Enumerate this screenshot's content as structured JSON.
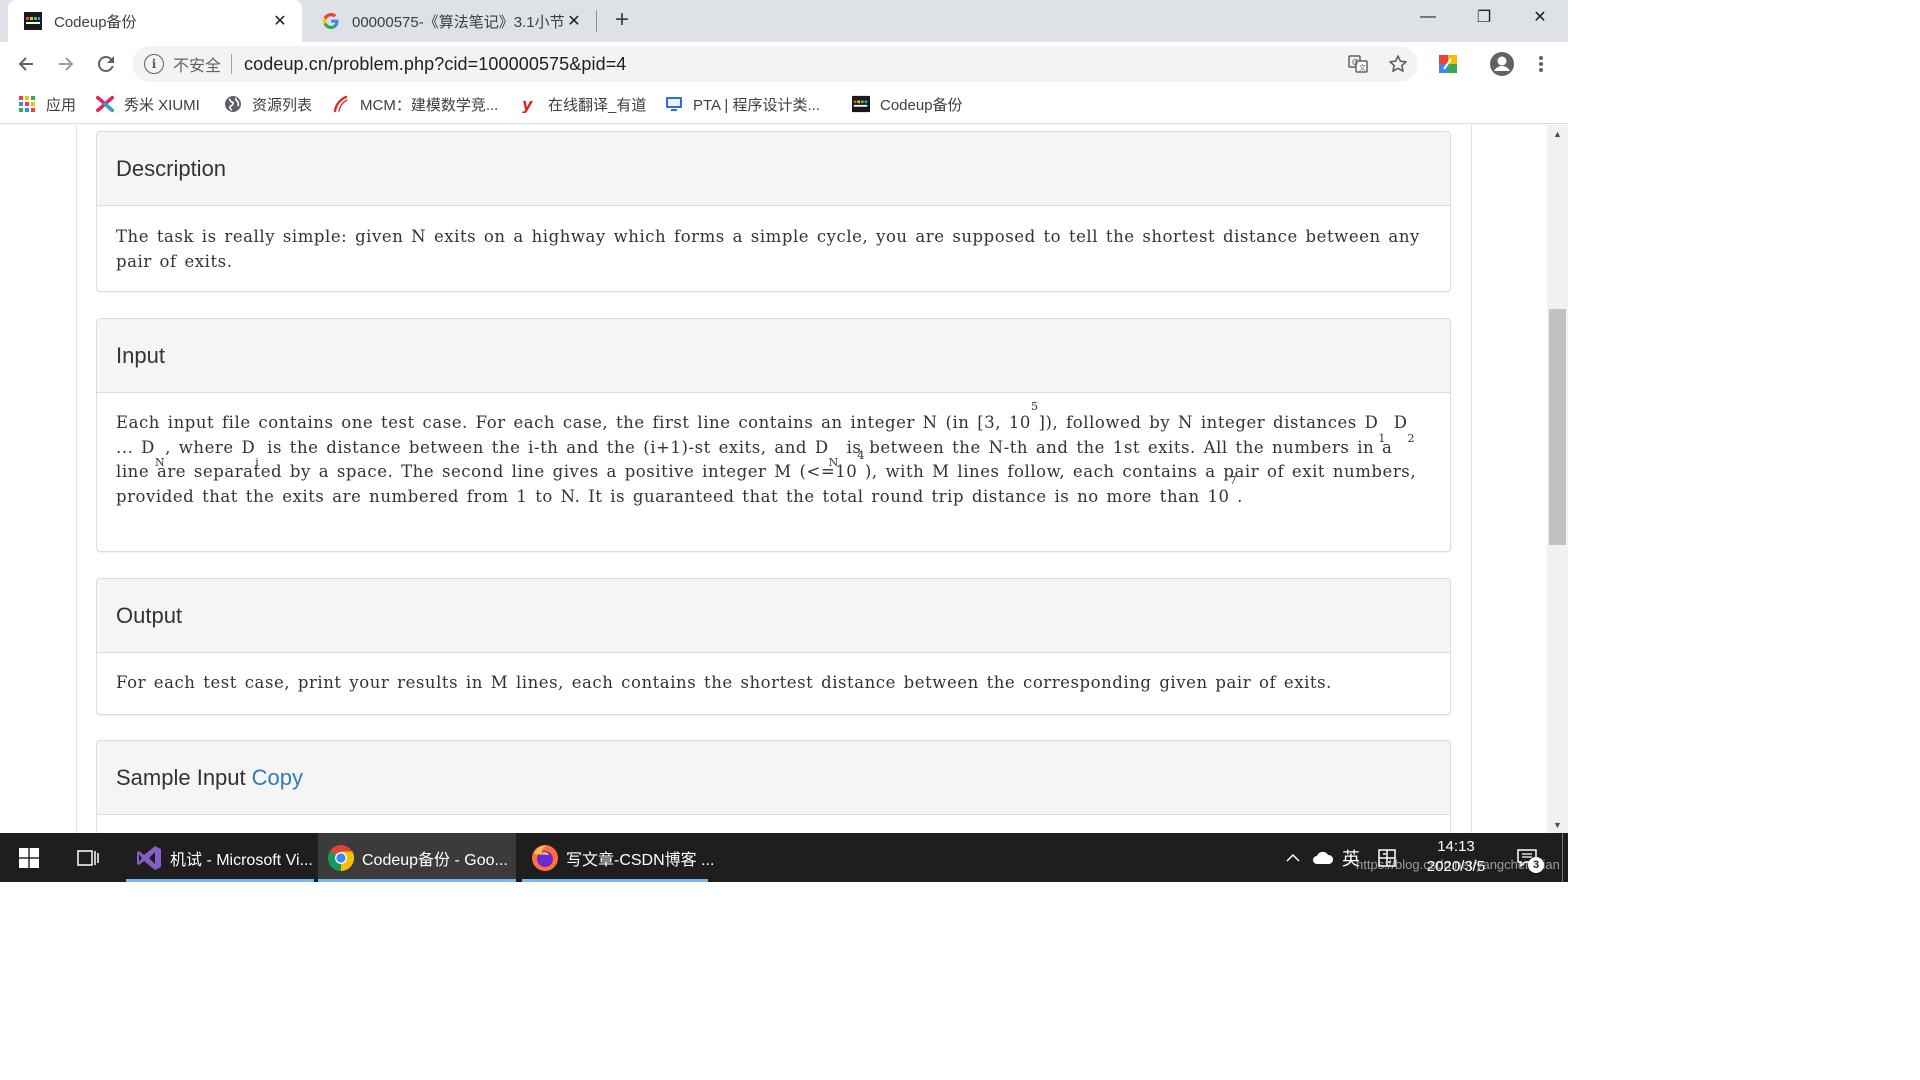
{
  "browser": {
    "tabs": [
      {
        "title": "Codeup备份",
        "close": "✕"
      },
      {
        "title": "00000575-《算法笔记》3.1小节",
        "close": "✕"
      }
    ],
    "new_tab": "+",
    "window_controls": {
      "minimize": "—",
      "restore": "❐",
      "close": "✕"
    },
    "address": {
      "security_label": "不安全",
      "url": "codeup.cn/problem.php?cid=100000575&pid=4"
    },
    "bookmarks": [
      {
        "label": "应用"
      },
      {
        "label": "秀米 XIUMI"
      },
      {
        "label": "资源列表"
      },
      {
        "label": "MCM：建模数学竞..."
      },
      {
        "label": "在线翻译_有道"
      },
      {
        "label": "PTA | 程序设计类..."
      },
      {
        "label": "Codeup备份"
      }
    ]
  },
  "problem": {
    "description": {
      "heading": "Description",
      "text": "The task is really simple: given N exits on a highway which forms a simple cycle, you are supposed to tell the shortest distance between any pair of exits."
    },
    "input": {
      "heading": "Input",
      "p1": "Each input file contains one test case. For each case, the first line contains an integer N (in [3, 10",
      "sup1": "5",
      "p2": "]), followed by N integer distances D",
      "sub1": "1",
      "p3": " D",
      "sub2": "2",
      "p4": " ... D",
      "sub3": "N",
      "p5": ", where D",
      "sub4": "i",
      "p6": " is the distance between the i-th and the (i+1)-st exits, and D",
      "sub5": "N",
      "p7": " is between the N-th and the 1st exits. All the numbers in a line are separated by a space. The second line gives a positive integer M (<=10",
      "sup2": "4",
      "p8": "), with M lines follow, each contains a pair of exit numbers, provided that the exits are numbered from 1 to N. It is guaranteed that the total round trip distance is no more than 10",
      "sup3": "7",
      "p9": "."
    },
    "output": {
      "heading": "Output",
      "text": "For each test case, print your results in M lines, each contains the shortest distance between the corresponding given pair of exits."
    },
    "sample_input": {
      "heading": "Sample Input",
      "copy_label": "Copy"
    }
  },
  "taskbar": {
    "apps": [
      {
        "label": "机试 - Microsoft Vi..."
      },
      {
        "label": "Codeup备份 - Goo..."
      },
      {
        "label": "写文章-CSDN博客 ..."
      }
    ],
    "ime": "英",
    "time": "14:13",
    "date": "2020/3/5",
    "notification_count": "3"
  },
  "watermark": "https://blog.csdn.net/yangchen_jian",
  "colors": {
    "link": "#337ab7",
    "panel_heading_bg": "#f5f5f5",
    "taskbar_bg": "#1e1e1e",
    "taskbar_active_underline": "#76b9ed"
  }
}
